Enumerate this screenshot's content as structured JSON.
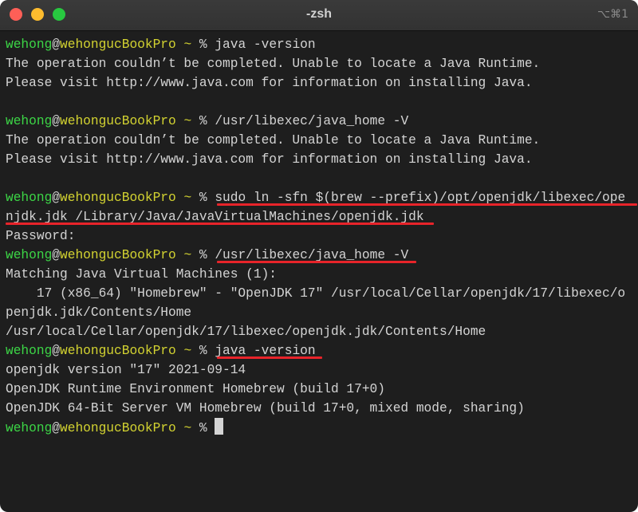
{
  "window": {
    "title": "-zsh",
    "shortcut": "⌥⌘1"
  },
  "prompt": {
    "user": "wehong",
    "at": "@",
    "host": "wehongucBookPro",
    "tilde": "~",
    "symbol": "% "
  },
  "terminal": {
    "cmd1": "java -version",
    "out1a": "The operation couldn’t be completed. Unable to locate a Java Runtime.",
    "out1b": "Please visit http://www.java.com for information on installing Java.",
    "cmd2": "/usr/libexec/java_home -V",
    "out2a": "The operation couldn’t be completed. Unable to locate a Java Runtime.",
    "out2b": "Please visit http://www.java.com for information on installing Java.",
    "cmd3a": "sudo ln -sfn $(brew --prefix)/opt/openjdk/libexec/ope",
    "cmd3b": "njdk.jdk /Library/Java/JavaVirtualMachines/openjdk.jdk",
    "out3": "Password:",
    "cmd4": "/usr/libexec/java_home -V",
    "out4a": "Matching Java Virtual Machines (1):",
    "out4b": "    17 (x86_64) \"Homebrew\" - \"OpenJDK 17\" /usr/local/Cellar/openjdk/17/libexec/o",
    "out4c": "penjdk.jdk/Contents/Home",
    "out4d": "/usr/local/Cellar/openjdk/17/libexec/openjdk.jdk/Contents/Home",
    "cmd5": "java -version",
    "out5a": "openjdk version \"17\" 2021-09-14",
    "out5b": "OpenJDK Runtime Environment Homebrew (build 17+0)",
    "out5c": "OpenJDK 64-Bit Server VM Homebrew (build 17+0, mixed mode, sharing)"
  },
  "colors": {
    "user": "#3cd646",
    "host": "#d3d331",
    "annotation": "#e8242a",
    "background": "#1e1e1e"
  }
}
